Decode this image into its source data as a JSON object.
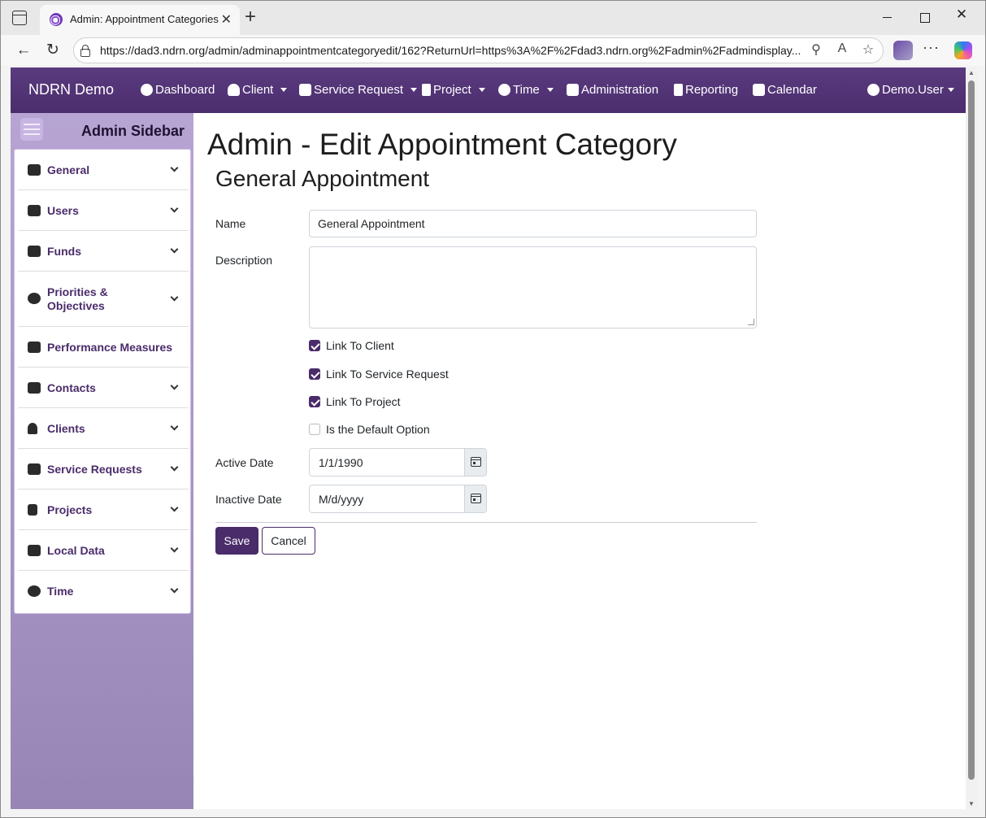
{
  "browser": {
    "tab_title": "Admin: Appointment Categories",
    "url": "https://dad3.ndrn.org/admin/adminappointmentcategoryedit/162?ReturnUrl=https%3A%2F%2Fdad3.ndrn.org%2Fadmin%2Fadmindisplay..."
  },
  "navbar": {
    "brand": "NDRN Demo",
    "items": [
      {
        "label": "Dashboard",
        "icon": "palette-icon",
        "dropdown": false
      },
      {
        "label": "Client",
        "icon": "person-icon",
        "dropdown": true
      },
      {
        "label": "Service Request",
        "icon": "briefcase-icon",
        "dropdown": true
      },
      {
        "label": "Project",
        "icon": "clipboard-icon",
        "dropdown": true
      },
      {
        "label": "Time",
        "icon": "clock-icon",
        "dropdown": true
      },
      {
        "label": "Administration",
        "icon": "tools-icon",
        "dropdown": false
      },
      {
        "label": "Reporting",
        "icon": "file-icon",
        "dropdown": false
      },
      {
        "label": "Calendar",
        "icon": "calendar-icon",
        "dropdown": false
      }
    ],
    "user": "Demo.User"
  },
  "sidebar": {
    "title": "Admin Sidebar",
    "items": [
      {
        "label": "General",
        "icon": "tools-icon",
        "expandable": true
      },
      {
        "label": "Users",
        "icon": "users-icon",
        "expandable": true
      },
      {
        "label": "Funds",
        "icon": "money-bag-icon",
        "expandable": true
      },
      {
        "label": "Priorities & Objectives",
        "icon": "target-icon",
        "expandable": true
      },
      {
        "label": "Performance Measures",
        "icon": "scale-icon",
        "expandable": false
      },
      {
        "label": "Contacts",
        "icon": "users-icon",
        "expandable": true
      },
      {
        "label": "Clients",
        "icon": "person-icon",
        "expandable": true
      },
      {
        "label": "Service Requests",
        "icon": "briefcase-icon",
        "expandable": true
      },
      {
        "label": "Projects",
        "icon": "clipboard-icon",
        "expandable": true
      },
      {
        "label": "Local Data",
        "icon": "house-icon",
        "expandable": true
      },
      {
        "label": "Time",
        "icon": "clock-icon",
        "expandable": true
      }
    ]
  },
  "main": {
    "title": "Admin - Edit Appointment Category",
    "subtitle": "General Appointment",
    "form": {
      "name_label": "Name",
      "name_value": "General Appointment",
      "description_label": "Description",
      "description_value": "",
      "checkboxes": [
        {
          "label": "Link To Client",
          "checked": true
        },
        {
          "label": "Link To Service Request",
          "checked": true
        },
        {
          "label": "Link To Project",
          "checked": true
        },
        {
          "label": "Is the Default Option",
          "checked": false
        }
      ],
      "active_date_label": "Active Date",
      "active_date_value": "1/1/1990",
      "inactive_date_label": "Inactive Date",
      "inactive_date_placeholder": "M/d/yyyy",
      "save_label": "Save",
      "cancel_label": "Cancel"
    }
  },
  "colors": {
    "navbar": "#4b2d6d",
    "accent": "#4a2c6a",
    "sidebar_bg": "#a996c8"
  }
}
